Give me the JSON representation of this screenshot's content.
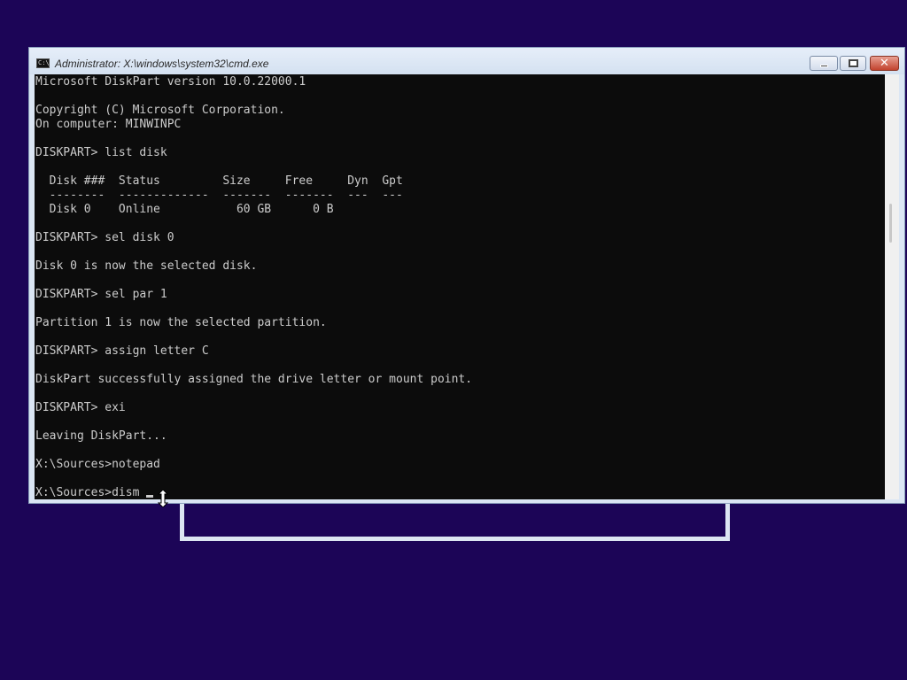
{
  "window": {
    "title": "Administrator: X:\\windows\\system32\\cmd.exe",
    "icon": "cmd-icon",
    "icon_text": "C:\\",
    "close_glyph": "✕"
  },
  "console": {
    "lines": [
      "Microsoft DiskPart version 10.0.22000.1",
      "",
      "Copyright (C) Microsoft Corporation.",
      "On computer: MINWINPC",
      "",
      "DISKPART> list disk",
      "",
      "  Disk ###  Status         Size     Free     Dyn  Gpt",
      "  --------  -------------  -------  -------  ---  ---",
      "  Disk 0    Online           60 GB      0 B",
      "",
      "DISKPART> sel disk 0",
      "",
      "Disk 0 is now the selected disk.",
      "",
      "DISKPART> sel par 1",
      "",
      "Partition 1 is now the selected partition.",
      "",
      "DISKPART> assign letter C",
      "",
      "DiskPart successfully assigned the drive letter or mount point.",
      "",
      "DISKPART> exi",
      "",
      "Leaving DiskPart...",
      "",
      "X:\\Sources>notepad",
      ""
    ],
    "input_line": "X:\\Sources>dism"
  },
  "colors": {
    "desktop": "#1c0557",
    "console_bg": "#0c0c0c",
    "console_text": "#cccccc",
    "close_button": "#c2432e"
  }
}
